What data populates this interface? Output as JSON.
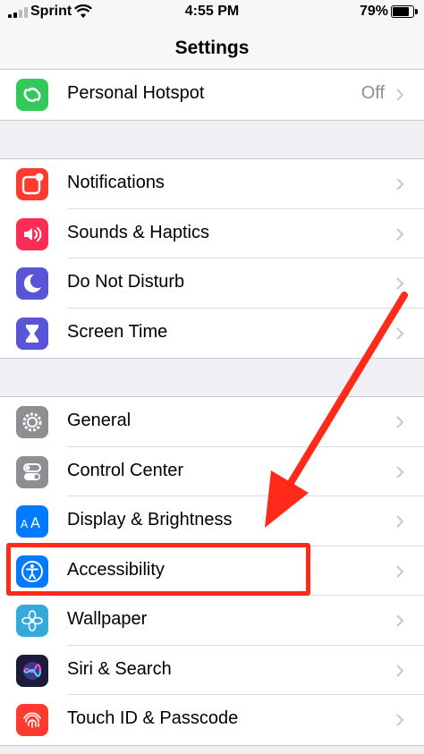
{
  "status_bar": {
    "carrier": "Sprint",
    "time": "4:55 PM",
    "battery": "79%",
    "battery_level": 0.79
  },
  "nav": {
    "title": "Settings"
  },
  "groups": [
    [
      {
        "label": "Personal Hotspot",
        "value": "Off",
        "icon": "hotspot-icon",
        "color": "#34c759"
      }
    ],
    [
      {
        "label": "Notifications",
        "icon": "notifications-icon",
        "color": "#ff3b30"
      },
      {
        "label": "Sounds & Haptics",
        "icon": "speaker-icon",
        "color": "#ff2d55"
      },
      {
        "label": "Do Not Disturb",
        "icon": "moon-icon",
        "color": "#5856d6"
      },
      {
        "label": "Screen Time",
        "icon": "hourglass-icon",
        "color": "#5856d6"
      }
    ],
    [
      {
        "label": "General",
        "icon": "gear-icon",
        "color": "#8e8e93"
      },
      {
        "label": "Control Center",
        "icon": "toggles-icon",
        "color": "#8e8e93"
      },
      {
        "label": "Display & Brightness",
        "icon": "text-size-icon",
        "color": "#007aff"
      },
      {
        "label": "Accessibility",
        "icon": "accessibility-icon",
        "color": "#007aff"
      },
      {
        "label": "Wallpaper",
        "icon": "flower-icon",
        "color": "#34aadc"
      },
      {
        "label": "Siri & Search",
        "icon": "siri-icon",
        "color": "#1c1c3a"
      },
      {
        "label": "Touch ID & Passcode",
        "icon": "fingerprint-icon",
        "color": "#ff3b30"
      }
    ]
  ],
  "annotation": {
    "highlight_color": "#ff2a1a"
  }
}
